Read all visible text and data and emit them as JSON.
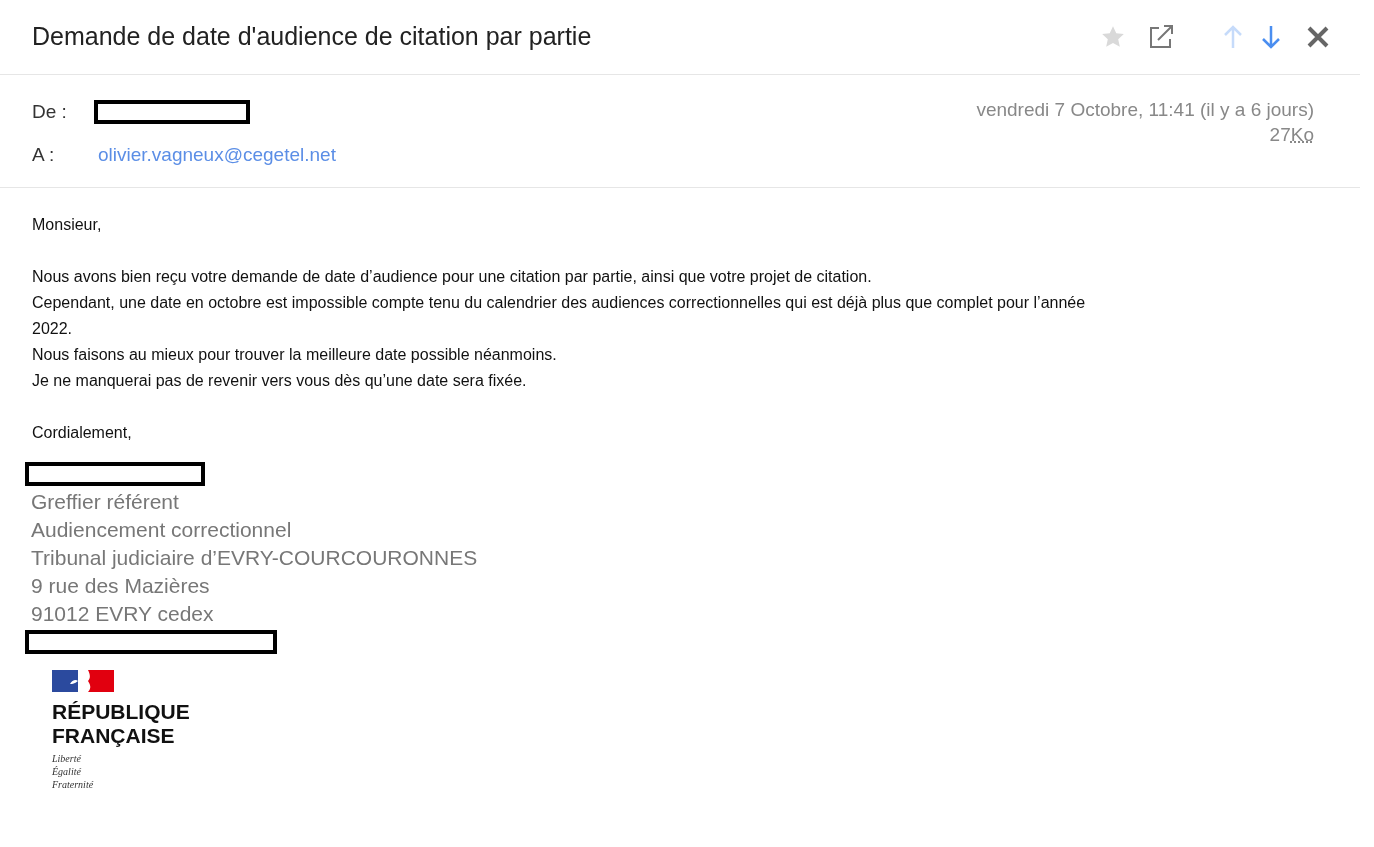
{
  "subject": "Demande de date d'audience de citation par partie",
  "toolbar": {
    "starred": false
  },
  "header": {
    "from": {
      "label": "De :",
      "kind": "redacted"
    },
    "to": {
      "label": "A :",
      "address": "olivier.vagneux@cegetel.net"
    },
    "date": "vendredi 7 Octobre, 11:41 (il y a 6 jours)",
    "size": "27",
    "size_unit": "Ko"
  },
  "body": {
    "greeting": "Monsieur,",
    "paragraphs": [
      "Nous avons bien reçu votre demande de date d’audience pour une citation par partie, ainsi que votre projet de citation.",
      "Cependant, une date en octobre est impossible compte tenu du calendrier des audiences correctionnelles qui est déjà plus que complet pour l’année 2022.",
      "Nous faisons au mieux pour trouver la meilleure date possible néanmoins.",
      "Je ne manquerai pas de revenir vers vous dès qu’une date sera fixée."
    ],
    "closing": "Cordialement,"
  },
  "signature": [
    {
      "kind": "redacted"
    },
    {
      "kind": "text",
      "text": "Greffier référent"
    },
    {
      "kind": "text",
      "text": "Audiencement correctionnel"
    },
    {
      "kind": "text",
      "text": "Tribunal judiciaire d’EVRY-COURCOURONNES"
    },
    {
      "kind": "text",
      "text": "9 rue des Mazières"
    },
    {
      "kind": "text",
      "text": "91012 EVRY cedex"
    },
    {
      "kind": "redacted"
    }
  ],
  "logo": {
    "name_lines": [
      "RÉPUBLIQUE",
      "FRANÇAISE"
    ],
    "motto": [
      "Liberté",
      "Égalité",
      "Fraternité"
    ]
  }
}
